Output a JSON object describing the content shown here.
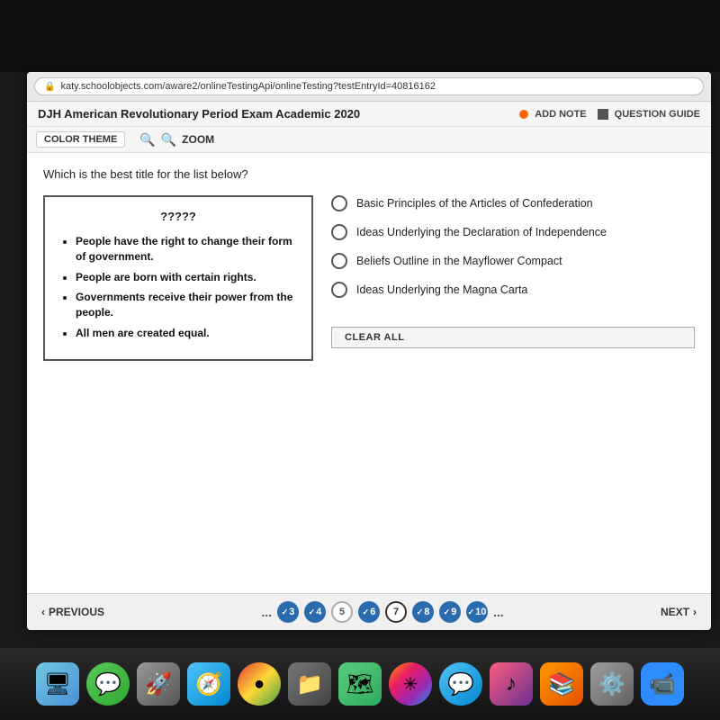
{
  "browser": {
    "url": "katy.schoolobjects.com/aware2/onlineTestingApi/onlineTesting?testEntryId=40816162"
  },
  "app": {
    "title": "DJH American Revolutionary Period Exam Academic 2020",
    "add_note_label": "ADD NOTE",
    "question_guide_label": "QUESTION GUIDE",
    "color_theme_label": "COLOR THEME",
    "zoom_label": "ZOOM"
  },
  "question": {
    "text": "Which is the best title for the list below?",
    "box_title": "?????",
    "bullets": [
      "People have the right to change their form of government.",
      "People are born with certain rights.",
      "Governments receive their power from the people.",
      "All men are created equal."
    ],
    "answers": [
      {
        "id": "a",
        "text": "Basic Principles of the Articles of Confederation"
      },
      {
        "id": "b",
        "text": "Ideas Underlying the Declaration of Independence"
      },
      {
        "id": "c",
        "text": "Beliefs Outline in the Mayflower Compact"
      },
      {
        "id": "d",
        "text": "Ideas Underlying the Magna Carta"
      }
    ],
    "clear_all_label": "CLEAR ALL"
  },
  "navigation": {
    "previous_label": "PREVIOUS",
    "next_label": "NEXT",
    "pages": [
      {
        "num": "3",
        "state": "checked"
      },
      {
        "num": "4",
        "state": "checked"
      },
      {
        "num": "5",
        "state": "empty"
      },
      {
        "num": "6",
        "state": "checked"
      },
      {
        "num": "7",
        "state": "current"
      },
      {
        "num": "8",
        "state": "checked"
      },
      {
        "num": "9",
        "state": "checked"
      },
      {
        "num": "10",
        "state": "checked"
      }
    ]
  },
  "dock": {
    "icons": [
      "finder",
      "messages",
      "rocket",
      "safari",
      "chrome",
      "launchpad",
      "maps",
      "photos",
      "messages2",
      "music",
      "books",
      "settings",
      "zoom"
    ]
  }
}
